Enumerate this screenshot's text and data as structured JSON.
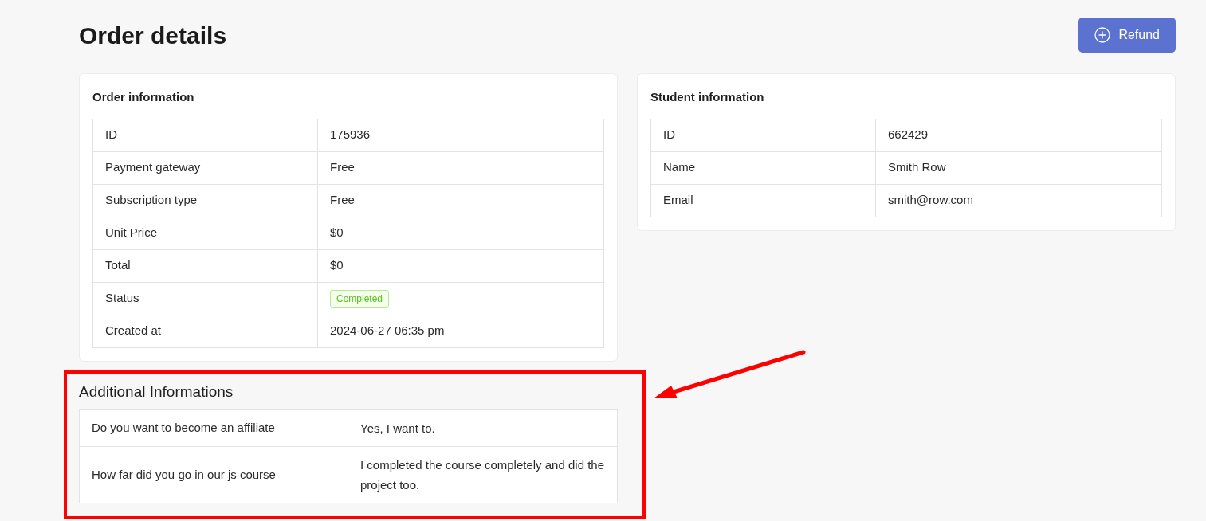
{
  "page_title": "Order details",
  "refund_button": {
    "label": "Refund"
  },
  "order_information": {
    "title": "Order information",
    "rows": [
      {
        "label": "ID",
        "value": "175936",
        "kind": "text"
      },
      {
        "label": "Payment gateway",
        "value": "Free",
        "kind": "text"
      },
      {
        "label": "Subscription type",
        "value": "Free",
        "kind": "text"
      },
      {
        "label": "Unit Price",
        "value": "$0",
        "kind": "text"
      },
      {
        "label": "Total",
        "value": "$0",
        "kind": "text"
      },
      {
        "label": "Status",
        "value": "Completed",
        "kind": "badge"
      },
      {
        "label": "Created at",
        "value": "2024-06-27 06:35 pm",
        "kind": "text"
      }
    ]
  },
  "student_information": {
    "title": "Student information",
    "rows": [
      {
        "label": "ID",
        "value": "662429",
        "kind": "text"
      },
      {
        "label": "Name",
        "value": "Smith Row",
        "kind": "text"
      },
      {
        "label": "Email",
        "value": "smith@row.com",
        "kind": "text"
      }
    ]
  },
  "additional_informations": {
    "title": "Additional Informations",
    "highlighted": true,
    "rows": [
      {
        "question": "Do you want to become an affiliate",
        "answer": "Yes, I want to."
      },
      {
        "question": "How far did you go in our js course",
        "answer": "I completed the course completely and did the project too."
      }
    ]
  }
}
